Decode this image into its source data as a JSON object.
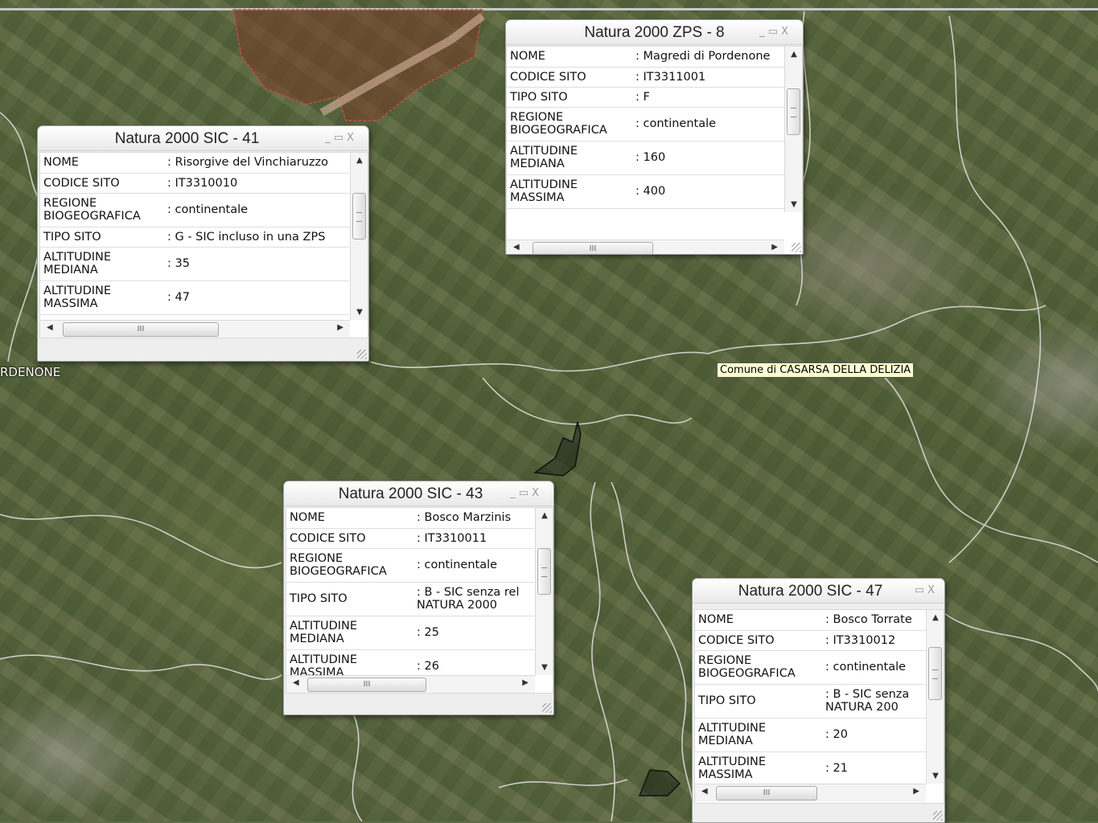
{
  "map": {
    "labels": {
      "pordenone": "RDENONE"
    },
    "tooltip": "Comune di CASARSA DELLA DELIZIA"
  },
  "window_controls": {
    "minimize": "_",
    "restore": "▭",
    "close": "X"
  },
  "popups": [
    {
      "title": "Natura 2000 ZPS - 8",
      "rows": [
        {
          "key": "NOME",
          "value": ": Magredi di Pordenone"
        },
        {
          "key": "CODICE SITO",
          "value": ": IT3311001"
        },
        {
          "key": "TIPO SITO",
          "value": ": F"
        },
        {
          "key": "REGIONE BIOGEOGRAFICA",
          "value": ": continentale"
        },
        {
          "key": "ALTITUDINE MEDIANA",
          "value": ": 160"
        },
        {
          "key": "ALTITUDINE MASSIMA",
          "value": ": 400"
        }
      ]
    },
    {
      "title": "Natura 2000 SIC - 41",
      "rows": [
        {
          "key": "NOME",
          "value": ": Risorgive del Vinchiaruzzo"
        },
        {
          "key": "CODICE SITO",
          "value": ": IT3310010"
        },
        {
          "key": "REGIONE BIOGEOGRAFICA",
          "value": ": continentale"
        },
        {
          "key": "TIPO SITO",
          "value": ": G - SIC incluso in una ZPS"
        },
        {
          "key": "ALTITUDINE MEDIANA",
          "value": ": 35"
        },
        {
          "key": "ALTITUDINE MASSIMA",
          "value": ": 47"
        }
      ]
    },
    {
      "title": "Natura 2000 SIC - 43",
      "rows": [
        {
          "key": "NOME",
          "value": ": Bosco Marzinis"
        },
        {
          "key": "CODICE SITO",
          "value": ": IT3310011"
        },
        {
          "key": "REGIONE BIOGEOGRAFICA",
          "value": ": continentale"
        },
        {
          "key": "TIPO SITO",
          "value": ": B - SIC senza rel NATURA 2000"
        },
        {
          "key": "ALTITUDINE MEDIANA",
          "value": ": 25"
        },
        {
          "key": "ALTITUDINE MASSIMA",
          "value": ": 26"
        }
      ]
    },
    {
      "title": "Natura 2000 SIC - 47",
      "rows": [
        {
          "key": "NOME",
          "value": ": Bosco Torrate"
        },
        {
          "key": "CODICE SITO",
          "value": ": IT3310012"
        },
        {
          "key": "REGIONE BIOGEOGRAFICA",
          "value": ": continentale"
        },
        {
          "key": "TIPO SITO",
          "value": ": B - SIC senza NATURA 200"
        },
        {
          "key": "ALTITUDINE MEDIANA",
          "value": ": 20"
        },
        {
          "key": "ALTITUDINE MASSIMA",
          "value": ": 21"
        }
      ]
    }
  ],
  "scroll_icons": {
    "up": "▲",
    "down": "▼",
    "left": "◀",
    "right": "▶",
    "grip": "III"
  }
}
